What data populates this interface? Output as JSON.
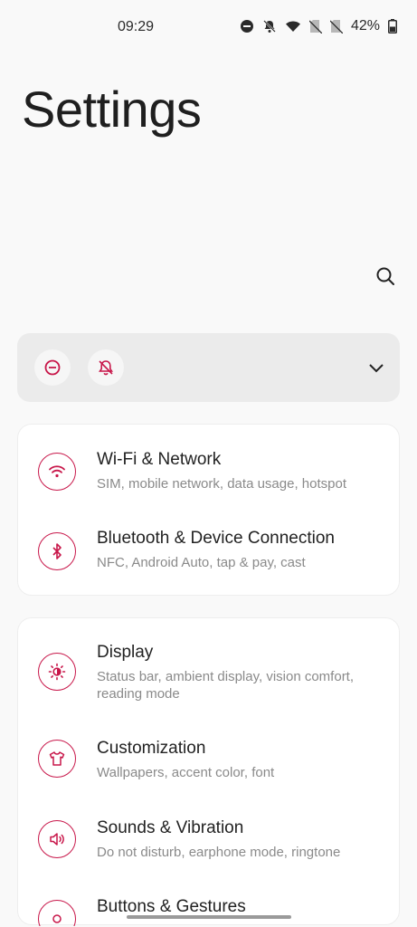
{
  "status_bar": {
    "time": "09:29",
    "battery": "42%",
    "icons": [
      "do-not-disturb-icon",
      "bell-off-icon",
      "wifi-icon",
      "no-sim-icon",
      "no-sim-icon",
      "battery-icon"
    ]
  },
  "header": {
    "title": "Settings"
  },
  "search": {
    "icon": "search-icon"
  },
  "quick_settings": {
    "chips": [
      "do-not-disturb-icon",
      "bell-off-icon"
    ],
    "expand_icon": "chevron-down-icon"
  },
  "groups": [
    {
      "items": [
        {
          "title": "Wi-Fi & Network",
          "subtitle": "SIM, mobile network, data usage, hotspot",
          "icon": "wifi-icon"
        },
        {
          "title": "Bluetooth & Device Connection",
          "subtitle": "NFC, Android Auto, tap & pay, cast",
          "icon": "bluetooth-icon"
        }
      ]
    },
    {
      "items": [
        {
          "title": "Display",
          "subtitle": "Status bar, ambient display, vision comfort, reading mode",
          "icon": "brightness-icon"
        },
        {
          "title": "Customization",
          "subtitle": "Wallpapers, accent color, font",
          "icon": "tshirt-icon"
        },
        {
          "title": "Sounds & Vibration",
          "subtitle": "Do not disturb, earphone mode, ringtone",
          "icon": "speaker-icon"
        },
        {
          "title": "Buttons & Gestures",
          "subtitle": "",
          "icon": "gesture-icon"
        }
      ]
    }
  ],
  "colors": {
    "accent": "#c8174a",
    "background": "#f9f9f9",
    "card": "#ffffff",
    "qs_bar": "#ebebeb"
  }
}
